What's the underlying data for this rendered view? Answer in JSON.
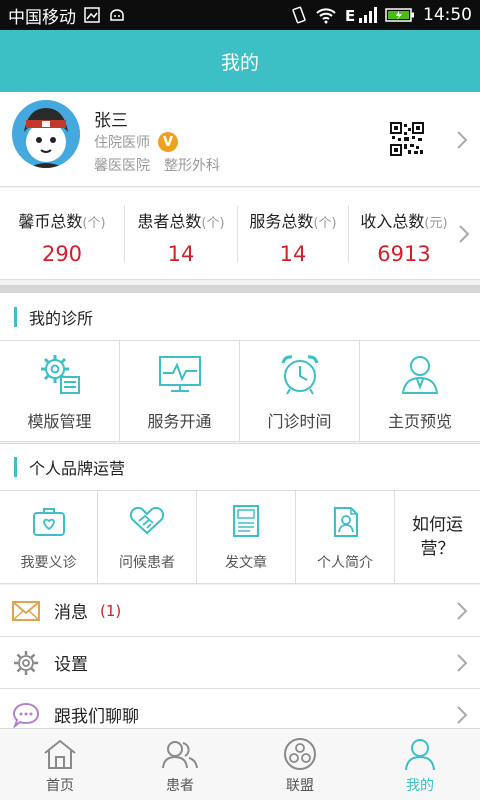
{
  "status_bar": {
    "carrier": "中国移动",
    "time": "14:50",
    "icons": [
      "image-icon",
      "android-icon",
      "vibrate-icon",
      "wifi-icon",
      "signal-icon",
      "battery-charging-icon"
    ]
  },
  "header": {
    "title": "我的"
  },
  "profile": {
    "name": "张三",
    "title": "住院医师",
    "verified_badge": "V",
    "hospital": "馨医医院",
    "department": "整形外科"
  },
  "stats": [
    {
      "label": "馨币总数",
      "unit": "(个)",
      "value": "290"
    },
    {
      "label": "患者总数",
      "unit": "(个)",
      "value": "14"
    },
    {
      "label": "服务总数",
      "unit": "(个)",
      "value": "14"
    },
    {
      "label": "收入总数",
      "unit": "(元)",
      "value": "6913"
    }
  ],
  "clinic": {
    "title": "我的诊所",
    "items": [
      {
        "label": "模版管理",
        "icon": "gear-template-icon"
      },
      {
        "label": "服务开通",
        "icon": "monitor-pulse-icon"
      },
      {
        "label": "门诊时间",
        "icon": "alarm-clock-icon"
      },
      {
        "label": "主页预览",
        "icon": "person-icon"
      }
    ]
  },
  "brand": {
    "title": "个人品牌运营",
    "items": [
      {
        "label": "我要义诊",
        "icon": "medical-bag-icon"
      },
      {
        "label": "问候患者",
        "icon": "handshake-icon"
      },
      {
        "label": "发文章",
        "icon": "article-icon"
      },
      {
        "label": "个人简介",
        "icon": "profile-card-icon"
      }
    ],
    "howto_line1": "如何运",
    "howto_line2": "营？"
  },
  "menu": [
    {
      "label": "消息",
      "badge": "(1)",
      "icon": "envelope-icon"
    },
    {
      "label": "设置",
      "badge": "",
      "icon": "gear-icon"
    },
    {
      "label": "跟我们聊聊",
      "badge": "",
      "icon": "chat-bubble-icon"
    }
  ],
  "nav": [
    {
      "label": "首页",
      "icon": "home-icon"
    },
    {
      "label": "患者",
      "icon": "patients-icon"
    },
    {
      "label": "联盟",
      "icon": "alliance-icon"
    },
    {
      "label": "我的",
      "icon": "me-icon"
    }
  ],
  "colors": {
    "accent": "#3dbfc6",
    "value_red": "#d0202b",
    "badge_orange": "#f0a020"
  }
}
